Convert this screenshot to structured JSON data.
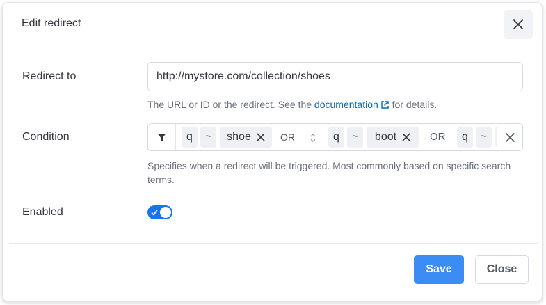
{
  "dialog": {
    "title": "Edit redirect",
    "close_icon": "close-icon"
  },
  "redirect_to": {
    "label": "Redirect to",
    "value": "http://mystore.com/collection/shoes",
    "help_prefix": "The URL or ID or the redirect. See the ",
    "help_link": "documentation",
    "help_suffix": " for details."
  },
  "condition": {
    "label": "Condition",
    "filter_icon": "filter-icon",
    "clauses": [
      {
        "field": "q",
        "operator": "~",
        "value": "shoe"
      },
      {
        "field": "q",
        "operator": "~",
        "value": "boot"
      },
      {
        "field": "q",
        "operator": "~",
        "value": ""
      }
    ],
    "connectors": [
      "OR",
      "OR"
    ],
    "help": "Specifies when a redirect will be triggered. Most commonly based on specific search terms."
  },
  "enabled": {
    "label": "Enabled",
    "checked": true
  },
  "footer": {
    "save_label": "Save",
    "close_label": "Close"
  },
  "colors": {
    "primary": "#3b8cf3",
    "toggle_on": "#1a73e8",
    "link": "#006bb8"
  }
}
